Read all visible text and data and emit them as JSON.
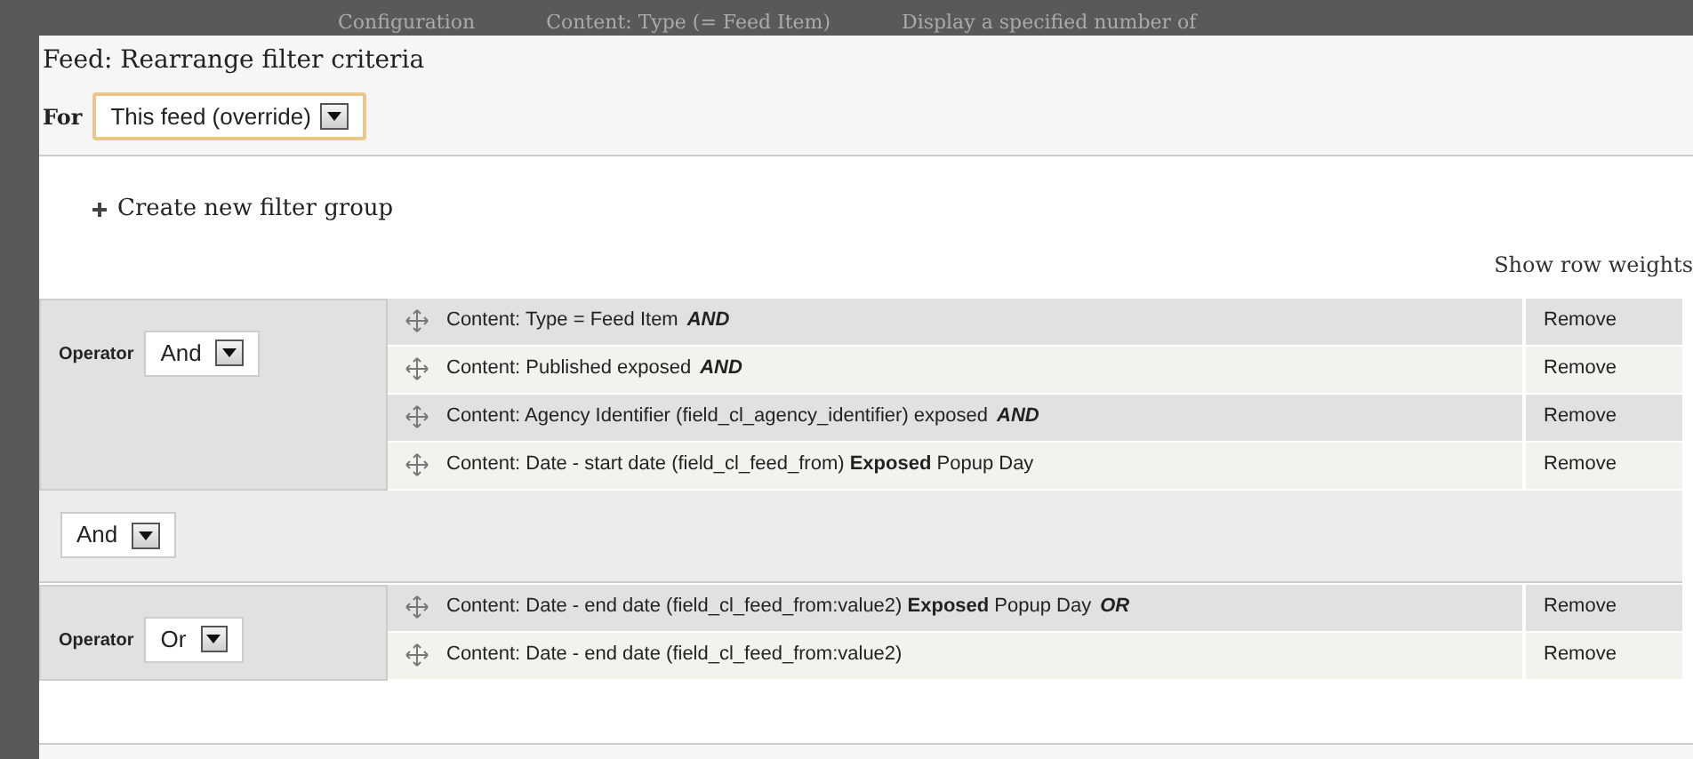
{
  "background": {
    "texts": [
      "Configuration",
      "Content: Type (= Feed Item)",
      "Display a specified number of"
    ]
  },
  "dialog": {
    "title": "Feed: Rearrange filter criteria",
    "for_label": "For",
    "for_value": "This feed (override)"
  },
  "create_group_link": "Create new filter group",
  "show_row_weights": "Show row weights",
  "groups": [
    {
      "operator_label": "Operator",
      "operator": "And",
      "rows": [
        {
          "text": "Content: Type = Feed Item",
          "operator": "AND",
          "action": "Remove"
        },
        {
          "text": "Content: Published exposed",
          "operator": "AND",
          "action": "Remove"
        },
        {
          "text": "Content: Agency Identifier (field_cl_agency_identifier) exposed",
          "operator": "AND",
          "action": "Remove"
        },
        {
          "text": "Content: Date - start date (field_cl_feed_from) **Exposed** Popup Day",
          "action": "Remove"
        }
      ]
    },
    {
      "operator_label": "Operator",
      "operator": "Or",
      "rows": [
        {
          "text": "Content: Date - end date (field_cl_feed_from:value2) **Exposed** Popup Day",
          "operator": "OR",
          "action": "Remove"
        },
        {
          "text": "Content: Date - end date (field_cl_feed_from:value2)",
          "action": "Remove"
        }
      ]
    }
  ],
  "groups_operator": "And"
}
